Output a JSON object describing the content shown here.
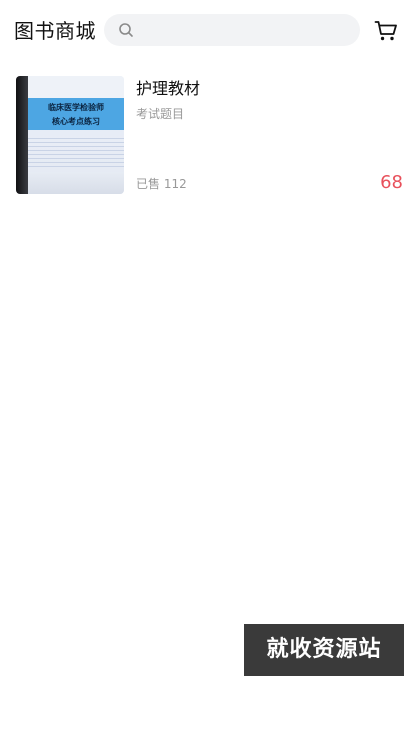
{
  "header": {
    "title": "图书商城",
    "search": {
      "placeholder": "",
      "value": ""
    },
    "cart_icon": "cart-icon",
    "search_icon": "search-icon"
  },
  "products": [
    {
      "name": "护理教材",
      "category": "考试题目",
      "sold_label": "已售",
      "sold_count": "112",
      "sold": "已售 112",
      "price": "68",
      "cover": {
        "title_line1": "临床医学检验师",
        "title_line2": "核心考点练习"
      }
    }
  ],
  "watermark": "就收资源站",
  "colors": {
    "price": "#e8505b",
    "search_bg": "#f2f3f5",
    "muted_text": "#999999",
    "watermark_bg": "#3a3a3a"
  }
}
